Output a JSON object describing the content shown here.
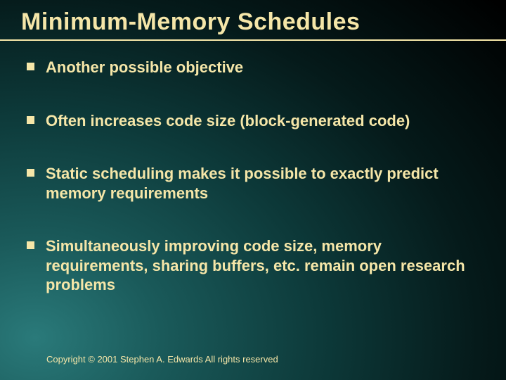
{
  "title": "Minimum-Memory Schedules",
  "bullets": [
    "Another possible objective",
    "Often increases code size (block-generated code)",
    "Static scheduling makes it possible to exactly predict memory requirements",
    "Simultaneously improving code size, memory requirements, sharing buffers, etc.  remain open research problems"
  ],
  "footer": "Copyright © 2001 Stephen A. Edwards  All rights reserved"
}
